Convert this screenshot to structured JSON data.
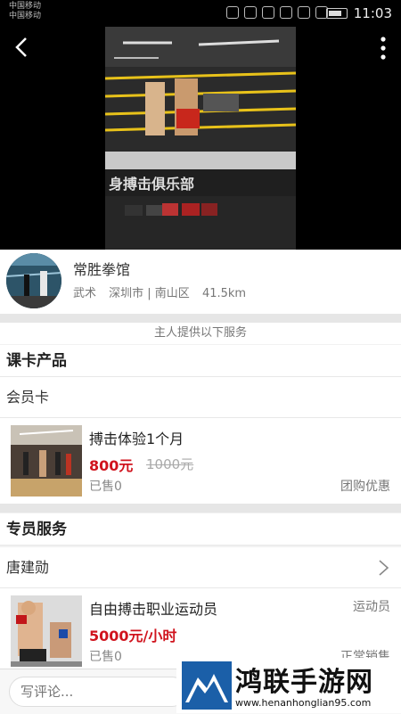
{
  "status_bar": {
    "carrier_1": "中国移动",
    "carrier_2": "中国移动",
    "time": "11:03"
  },
  "video_header": {
    "back_icon": "back-arrow-icon",
    "more_icon": "more-vertical-icon",
    "banner_text": "身搏击俱乐部"
  },
  "venue": {
    "name": "常胜拳馆",
    "category": "武术",
    "location": "深圳市 | 南山区",
    "distance": "41.5km"
  },
  "services_note": "主人提供以下服务",
  "course_section": {
    "title": "课卡产品",
    "card_type": "会员卡",
    "product": {
      "name": "搏击体验1个月",
      "price": "800元",
      "original_price": "1000元",
      "sold": "已售0",
      "tag": "团购优惠"
    }
  },
  "staff_section": {
    "title": "专员服务",
    "staff_name": "唐建勋",
    "service": {
      "name": "自由搏击职业运动员",
      "price": "5000元/小时",
      "sold": "已售0",
      "role": "运动员",
      "tag_partial": "正常销售"
    }
  },
  "bottom_bar": {
    "comment_placeholder": "写评论..."
  },
  "watermark": {
    "title": "鸿联手游网",
    "url": "www.henanhonglian95.com"
  },
  "colors": {
    "price_red": "#d0131d",
    "background": "#f2f2f2",
    "divider_band": "#e6e6e6"
  }
}
